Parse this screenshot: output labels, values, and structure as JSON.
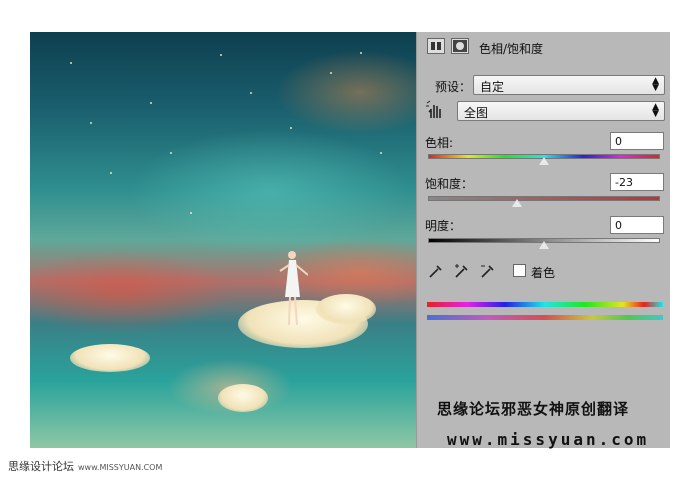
{
  "panel": {
    "title": "色相/饱和度",
    "preset_label": "预设：",
    "preset_value": "自定",
    "channel_value": "全图",
    "hue_label": "色相:",
    "hue_value": "0",
    "saturation_label": "饱和度：",
    "saturation_value": "-23",
    "lightness_label": "明度：",
    "lightness_value": "0",
    "colorize_label": "着色",
    "colorize_checked": false,
    "hue_level": 0.5,
    "saturation_level": 0.385,
    "lightness_level": 0.5
  },
  "watermark": {
    "line1": "思缘论坛邪恶女神原创翻译",
    "line2": "www.missyuan.com"
  },
  "footer": {
    "site_name": "思缘设计论坛",
    "site_url": "www.MISSYUAN.COM"
  },
  "icons": [
    "adjustment-layer-icon",
    "mask-icon",
    "target-adjust-hand-icon",
    "eyedropper-icon",
    "eyedropper-plus-icon",
    "eyedropper-minus-icon"
  ]
}
